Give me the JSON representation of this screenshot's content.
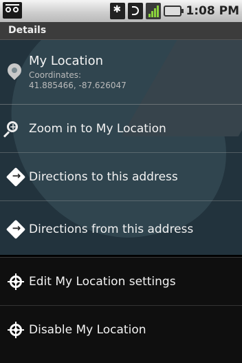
{
  "status_bar": {
    "time": "1:08 PM",
    "icons": [
      "voicemail-icon",
      "bluetooth-icon",
      "wifi-icon",
      "signal-icon",
      "battery-icon"
    ]
  },
  "title_bar": {
    "title": "Details"
  },
  "location": {
    "name": "My Location",
    "coordinates_label": "Coordinates:",
    "coordinates": "41.885466, -87.626047"
  },
  "menu": {
    "zoom": "Zoom in to My Location",
    "directions_to": "Directions to this address",
    "directions_from": "Directions from this address",
    "edit_settings": "Edit My Location settings",
    "disable": "Disable My Location"
  }
}
